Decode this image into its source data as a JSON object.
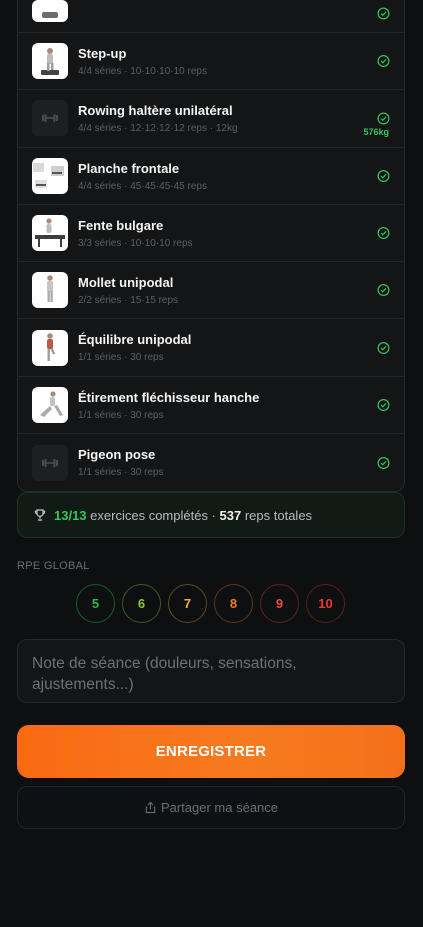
{
  "exercises": [
    {
      "name": "",
      "meta": "",
      "thumb": "photo",
      "icon": "exercise-thumbnail-icon",
      "volume": ""
    },
    {
      "name": "Step-up",
      "meta": "4/4 séries · 10·10·10·10 reps",
      "thumb": "photo",
      "icon": "step-up-thumbnail-icon",
      "volume": ""
    },
    {
      "name": "Rowing haltère unilatéral",
      "meta": "4/4 séries · 12·12·12·12 reps · 12kg",
      "thumb": "dark",
      "icon": "dumbbell-icon",
      "volume": "576kg"
    },
    {
      "name": "Planche frontale",
      "meta": "4/4 séries · 45·45·45·45 reps",
      "thumb": "photo",
      "icon": "plank-thumbnail-icon",
      "volume": ""
    },
    {
      "name": "Fente bulgare",
      "meta": "3/3 séries · 10·10·10 reps",
      "thumb": "photo",
      "icon": "lunge-thumbnail-icon",
      "volume": ""
    },
    {
      "name": "Mollet unipodal",
      "meta": "2/2 séries · 15·15 reps",
      "thumb": "photo",
      "icon": "calf-raise-thumbnail-icon",
      "volume": ""
    },
    {
      "name": "Équilibre unipodal",
      "meta": "1/1 séries · 30 reps",
      "thumb": "photo",
      "icon": "balance-thumbnail-icon",
      "volume": ""
    },
    {
      "name": "Étirement fléchisseur hanche",
      "meta": "1/1 séries · 30 reps",
      "thumb": "photo",
      "icon": "hip-stretch-thumbnail-icon",
      "volume": ""
    },
    {
      "name": "Pigeon pose",
      "meta": "1/1 séries · 30 reps",
      "thumb": "dark",
      "icon": "dumbbell-icon",
      "volume": ""
    }
  ],
  "summary": {
    "count": "13/13",
    "count_label": "exercices complétés ·",
    "reps": "537",
    "reps_label": "reps totales"
  },
  "rpe": {
    "title": "RPE GLOBAL",
    "values": [
      {
        "label": "5",
        "color": "#2fb34f"
      },
      {
        "label": "6",
        "color": "#8cc63f"
      },
      {
        "label": "7",
        "color": "#f2b233"
      },
      {
        "label": "8",
        "color": "#f37b20"
      },
      {
        "label": "9",
        "color": "#ef4b3c"
      },
      {
        "label": "10",
        "color": "#e53935"
      }
    ]
  },
  "note": {
    "placeholder": "Note de séance (douleurs, sensations, ajustements...)"
  },
  "actions": {
    "save_label": "ENREGISTRER",
    "share_label": "Partager ma séance"
  },
  "colors": {
    "accent": "#f77a1e",
    "success": "#34c759",
    "background": "#0e0f10"
  }
}
